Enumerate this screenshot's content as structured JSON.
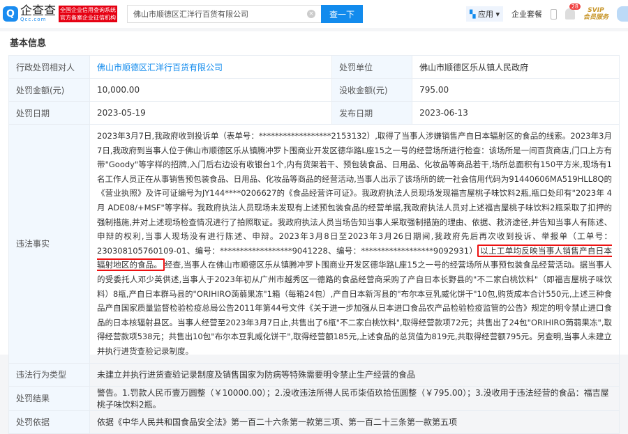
{
  "header": {
    "logo_name": "企查查",
    "logo_domain": "Qcc.com",
    "badge_line1": "全国企业信用查询系统",
    "badge_line2": "官方备案企业征信机构",
    "search_value": "佛山市顺德区汇洋行百货有限公司",
    "search_button": "查一下",
    "apps": "应用",
    "enterprise_package": "企业套餐",
    "notification_count": "28",
    "svip": "SVIP",
    "svip_sub": "会员服务"
  },
  "section_title": "基本信息",
  "rows": {
    "party_label": "行政处罚相对人",
    "party_value": "佛山市顺德区汇洋行百货有限公司",
    "unit_label": "处罚单位",
    "unit_value": "佛山市顺德区乐从镇人民政府",
    "fine_label": "处罚金额(元)",
    "fine_value": "10,000.00",
    "confiscation_label": "没收金额(元)",
    "confiscation_value": "795.00",
    "date_label": "处罚日期",
    "date_value": "2023-05-19",
    "publish_label": "发布日期",
    "publish_value": "2023-06-13",
    "facts_label": "违法事实",
    "facts_before": "2023年3月7日,我政府收到投诉单（表单号：******************2153132）,取得了当事人涉嫌销售产自日本辐射区的食品的线索。2023年3月7日,我政府到当事人位于佛山市顺德区乐从镇腾冲罗卜围商业开发区德华路L座15之一号的经营场所进行检查：该场所是一间百货商店,门口上方有带\"Goody\"等字样的招牌,入门后右边设有收银台1个,内有货架若干、预包装食品、日用品、化妆品等商品若干,场所总面积有150平方米,现场有1名工作人员正在从事销售预包装食品、日用品、化妆品等商品的经营活动,当事人出示了该场所的统一社会信用代码为91440606MA519HLL8Q的《营业执照》及许可证编号为JY144****0206627的《食品经营许可证》。我政府执法人员现场发现福吉屋桃子味饮料2瓶,瓶口处印有\"2023年 4月 ADE08/+MSF\"等字样。我政府执法人员现场未发现有上述预包装食品的经营单据,我政府执法人员对上述福吉屋桃子味饮料2瓶采取了扣押的强制措施,并对上述现场检查情况进行了拍照取证。我政府执法人员当场告知当事人采取强制措施的理由、依据、救济途径,并告知当事人有陈述、申辩的权利,当事人现场没有进行陈述、申辩。2023年3月8日至2023年3月26日期间,我政府先后再次收到投诉、举报单（工单号：230308105760109-01、编号：******************9041228、编号：******************9092931）",
    "facts_highlight": "以上工单均反映当事人销售产自日本辐射地区的食品。",
    "facts_after": "经查,当事人在佛山市顺德区乐从镇腾冲罗卜围商业开发区德华路L座15之一号的经营场所从事预包装食品经营活动。据当事人的受委托人邓少英供述,当事人于2023年初从广州市越秀区一德路的食品经营商采购了产自日本长野县的\"不二家白桃饮料\"（即福吉屋桃子味饮料）8瓶,产自日本群马县的\"ORIHIRO蒟蒻果冻\"1箱（每箱24包）,产自日本新泻县的\"布尔本豆乳威化饼干\"10包,购货成本合计550元,上述三种食品产自国家质量监督检验检疫总局公告2011年第44号文件《关于进一步加强从日本进口食品农产品检验检疫监管的公告》规定的明令禁止进口食品的日本核辐射县区。当事人经营至2023年3月7日止,共售出了6瓶\"不二家白桃饮料\",取得经营款项72元；共售出了24包\"ORIHIRO蒟蒻果冻\",取得经营款项538元；共售出10包\"布尔本豆乳威化饼干\",取得经营额185元,上述食品的总货值为819元,共取得经营额795元。另查明,当事人未建立并执行进货查验记录制度。",
    "type_label": "违法行为类型",
    "type_value": "未建立并执行进货查验记录制度及销售国家为防病等特殊需要明令禁止生产经营的食品",
    "result_label": "处罚结果",
    "result_value": "警告。1.罚款人民币壹万圆整（￥10000.00）；2.没收违法所得人民币柒佰玖拾伍圆整（￥795.00）；3.没收用于违法经营的食品：福吉屋桃子味饮料2瓶。",
    "basis_label": "处罚依据",
    "basis_value": "依据《中华人民共和国食品安全法》第一百二十六条第一款第三项、第一百二十三条第一款第五项"
  }
}
